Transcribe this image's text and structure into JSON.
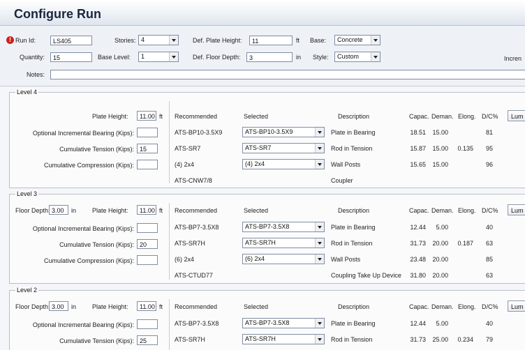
{
  "window": {
    "title": "Configure Run"
  },
  "form": {
    "run_id_label": "Run Id:",
    "run_id_value": "LS405",
    "quantity_label": "Quantity:",
    "quantity_value": "15",
    "stories_label": "Stories:",
    "stories_value": "4",
    "base_level_label": "Base Level:",
    "base_level_value": "1",
    "def_plate_height_label": "Def. Plate Height:",
    "def_plate_height_value": "11",
    "def_plate_height_unit": "ft",
    "def_floor_depth_label": "Def. Floor Depth:",
    "def_floor_depth_value": "3",
    "def_floor_depth_unit": "in",
    "base_label": "Base:",
    "base_value": "Concrete",
    "style_label": "Style:",
    "style_value": "Custom",
    "incre_label": "Incren",
    "notes_label": "Notes:",
    "notes_value": ""
  },
  "headers": {
    "plate_height": "Plate Height:",
    "floor_depth": "Floor Depth:",
    "inc_bearing": "Optional Incremental Bearing (Kips):",
    "cum_tension": "Cumulative Tension (Kips):",
    "cum_compression": "Cumulative Compression (Kips):",
    "recommended": "Recommended",
    "selected": "Selected",
    "description": "Description",
    "capac": "Capac.",
    "deman": "Deman.",
    "elong": "Elong.",
    "dc": "D/C%",
    "button": "Lum"
  },
  "levels": [
    {
      "title": "Level 4",
      "floor_depth": "",
      "floor_unit": "",
      "plate_height": "11.00",
      "plate_unit": "ft",
      "inc_bearing": "",
      "cum_tension": "15",
      "cum_compression": "",
      "rows": [
        {
          "rec": "ATS-BP10-3.5X9",
          "sel": "ATS-BP10-3.5X9",
          "desc": "Plate in Bearing",
          "capac": "18.51",
          "deman": "15.00",
          "elong": "",
          "dc": "81"
        },
        {
          "rec": "ATS-SR7",
          "sel": "ATS-SR7",
          "desc": "Rod in Tension",
          "capac": "15.87",
          "deman": "15.00",
          "elong": "0.135",
          "dc": "95"
        },
        {
          "rec": "(4) 2x4",
          "sel": "(4) 2x4",
          "desc": "Wall Posts",
          "capac": "15.65",
          "deman": "15.00",
          "elong": "",
          "dc": "96"
        },
        {
          "rec": "ATS-CNW7/8",
          "sel": "",
          "desc": "Coupler",
          "capac": "",
          "deman": "",
          "elong": "",
          "dc": ""
        }
      ]
    },
    {
      "title": "Level 3",
      "floor_depth": "3.00",
      "floor_unit": "in",
      "plate_height": "11.00",
      "plate_unit": "ft",
      "inc_bearing": "",
      "cum_tension": "20",
      "cum_compression": "",
      "rows": [
        {
          "rec": "ATS-BP7-3.5X8",
          "sel": "ATS-BP7-3.5X8",
          "desc": "Plate in Bearing",
          "capac": "12.44",
          "deman": "5.00",
          "elong": "",
          "dc": "40"
        },
        {
          "rec": "ATS-SR7H",
          "sel": "ATS-SR7H",
          "desc": "Rod in Tension",
          "capac": "31.73",
          "deman": "20.00",
          "elong": "0.187",
          "dc": "63"
        },
        {
          "rec": "(6) 2x4",
          "sel": "(6) 2x4",
          "desc": "Wall Posts",
          "capac": "23.48",
          "deman": "20.00",
          "elong": "",
          "dc": "85"
        },
        {
          "rec": "ATS-CTUD77",
          "sel": "",
          "desc": "Coupling Take Up Device",
          "capac": "31.80",
          "deman": "20.00",
          "elong": "",
          "dc": "63"
        }
      ]
    },
    {
      "title": "Level 2",
      "floor_depth": "3.00",
      "floor_unit": "in",
      "plate_height": "11.00",
      "plate_unit": "ft",
      "inc_bearing": "",
      "cum_tension": "25",
      "cum_compression": "",
      "rows": [
        {
          "rec": "ATS-BP7-3.5X8",
          "sel": "ATS-BP7-3.5X8",
          "desc": "Plate in Bearing",
          "capac": "12.44",
          "deman": "5.00",
          "elong": "",
          "dc": "40"
        },
        {
          "rec": "ATS-SR7H",
          "sel": "ATS-SR7H",
          "desc": "Rod in Tension",
          "capac": "31.73",
          "deman": "25.00",
          "elong": "0.234",
          "dc": "79"
        }
      ]
    }
  ]
}
